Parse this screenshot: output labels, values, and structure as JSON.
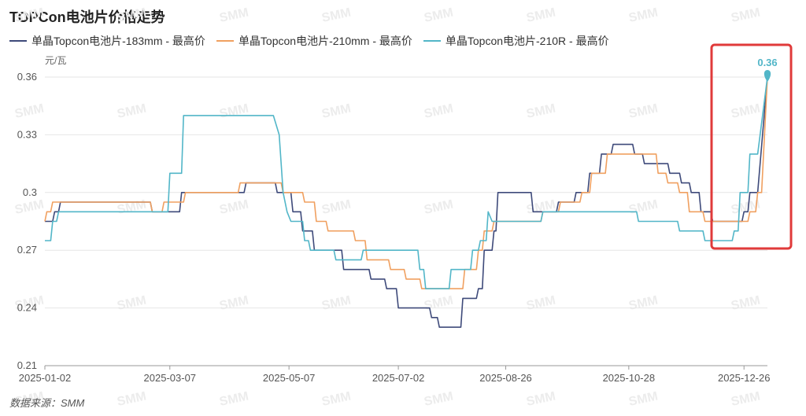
{
  "title": "TOPCon电池片价格走势",
  "unit_label": "元/瓦",
  "source": "数据来源：SMM",
  "watermark": "SMM",
  "colors": {
    "s183": "#3e4a7a",
    "s210": "#f0a060",
    "s210r": "#52b6c8",
    "highlight": "#e03a3a"
  },
  "chart_data": {
    "type": "line",
    "ylim": [
      0.21,
      0.36
    ],
    "yticks": [
      0.21,
      0.24,
      0.27,
      0.3,
      0.33,
      0.36
    ],
    "ytick_labels": [
      "0.21",
      "0.24",
      "0.27",
      "0.3",
      "0.33",
      "0.36"
    ],
    "xtick_labels": [
      "2025-01-02",
      "2025-03-07",
      "2025-05-07",
      "2025-07-02",
      "2025-08-26",
      "2025-10-28",
      "2025-12-26"
    ],
    "x_range": [
      "2025-01-02",
      "2026-01-07"
    ],
    "annotation": {
      "date": "2026-01-07",
      "value": 0.36,
      "label": "0.36"
    },
    "series": [
      {
        "name": "单晶Topcon电池片-183mm - 最高价",
        "color": "#3e4a7a",
        "points": [
          [
            "2025-01-02",
            0.285
          ],
          [
            "2025-01-06",
            0.285
          ],
          [
            "2025-01-07",
            0.29
          ],
          [
            "2025-01-09",
            0.29
          ],
          [
            "2025-01-10",
            0.295
          ],
          [
            "2025-02-25",
            0.295
          ],
          [
            "2025-02-26",
            0.29
          ],
          [
            "2025-03-12",
            0.29
          ],
          [
            "2025-03-13",
            0.3
          ],
          [
            "2025-04-14",
            0.3
          ],
          [
            "2025-04-15",
            0.305
          ],
          [
            "2025-04-30",
            0.305
          ],
          [
            "2025-05-01",
            0.3
          ],
          [
            "2025-05-08",
            0.3
          ],
          [
            "2025-05-09",
            0.29
          ],
          [
            "2025-05-13",
            0.29
          ],
          [
            "2025-05-14",
            0.28
          ],
          [
            "2025-05-19",
            0.28
          ],
          [
            "2025-05-20",
            0.27
          ],
          [
            "2025-05-26",
            0.27
          ],
          [
            "2025-05-27",
            0.27
          ],
          [
            "2025-06-03",
            0.27
          ],
          [
            "2025-06-04",
            0.26
          ],
          [
            "2025-06-17",
            0.26
          ],
          [
            "2025-06-18",
            0.255
          ],
          [
            "2025-06-25",
            0.255
          ],
          [
            "2025-06-26",
            0.25
          ],
          [
            "2025-07-01",
            0.25
          ],
          [
            "2025-07-02",
            0.24
          ],
          [
            "2025-07-18",
            0.24
          ],
          [
            "2025-07-19",
            0.235
          ],
          [
            "2025-07-22",
            0.235
          ],
          [
            "2025-07-23",
            0.23
          ],
          [
            "2025-08-03",
            0.23
          ],
          [
            "2025-08-04",
            0.245
          ],
          [
            "2025-08-11",
            0.245
          ],
          [
            "2025-08-12",
            0.25
          ],
          [
            "2025-08-14",
            0.25
          ],
          [
            "2025-08-15",
            0.27
          ],
          [
            "2025-08-19",
            0.27
          ],
          [
            "2025-08-20",
            0.28
          ],
          [
            "2025-08-21",
            0.28
          ],
          [
            "2025-08-22",
            0.3
          ],
          [
            "2025-09-08",
            0.3
          ],
          [
            "2025-09-09",
            0.29
          ],
          [
            "2025-09-21",
            0.29
          ],
          [
            "2025-09-22",
            0.295
          ],
          [
            "2025-09-30",
            0.295
          ],
          [
            "2025-10-01",
            0.3
          ],
          [
            "2025-10-07",
            0.3
          ],
          [
            "2025-10-08",
            0.31
          ],
          [
            "2025-10-13",
            0.31
          ],
          [
            "2025-10-14",
            0.32
          ],
          [
            "2025-10-19",
            0.32
          ],
          [
            "2025-10-20",
            0.325
          ],
          [
            "2025-10-30",
            0.325
          ],
          [
            "2025-10-31",
            0.32
          ],
          [
            "2025-11-04",
            0.32
          ],
          [
            "2025-11-05",
            0.315
          ],
          [
            "2025-11-17",
            0.315
          ],
          [
            "2025-11-18",
            0.31
          ],
          [
            "2025-11-23",
            0.31
          ],
          [
            "2025-11-24",
            0.305
          ],
          [
            "2025-11-28",
            0.305
          ],
          [
            "2025-11-29",
            0.3
          ],
          [
            "2025-12-03",
            0.3
          ],
          [
            "2025-12-04",
            0.29
          ],
          [
            "2025-12-09",
            0.29
          ],
          [
            "2025-12-10",
            0.285
          ],
          [
            "2025-12-25",
            0.285
          ],
          [
            "2025-12-26",
            0.29
          ],
          [
            "2025-12-28",
            0.29
          ],
          [
            "2025-12-29",
            0.3
          ],
          [
            "2026-01-02",
            0.3
          ],
          [
            "2026-01-07",
            0.36
          ]
        ]
      },
      {
        "name": "单晶Topcon电池片-210mm - 最高价",
        "color": "#f0a060",
        "points": [
          [
            "2025-01-02",
            0.285
          ],
          [
            "2025-01-03",
            0.29
          ],
          [
            "2025-01-05",
            0.29
          ],
          [
            "2025-01-06",
            0.295
          ],
          [
            "2025-02-25",
            0.295
          ],
          [
            "2025-02-26",
            0.29
          ],
          [
            "2025-03-03",
            0.29
          ],
          [
            "2025-03-04",
            0.295
          ],
          [
            "2025-03-14",
            0.295
          ],
          [
            "2025-03-15",
            0.3
          ],
          [
            "2025-04-11",
            0.3
          ],
          [
            "2025-04-12",
            0.305
          ],
          [
            "2025-05-03",
            0.305
          ],
          [
            "2025-05-04",
            0.3
          ],
          [
            "2025-05-14",
            0.3
          ],
          [
            "2025-05-15",
            0.295
          ],
          [
            "2025-05-20",
            0.295
          ],
          [
            "2025-05-21",
            0.285
          ],
          [
            "2025-05-26",
            0.285
          ],
          [
            "2025-05-27",
            0.28
          ],
          [
            "2025-06-09",
            0.28
          ],
          [
            "2025-06-10",
            0.275
          ],
          [
            "2025-06-15",
            0.275
          ],
          [
            "2025-06-16",
            0.265
          ],
          [
            "2025-06-27",
            0.265
          ],
          [
            "2025-06-28",
            0.26
          ],
          [
            "2025-07-05",
            0.26
          ],
          [
            "2025-07-06",
            0.255
          ],
          [
            "2025-07-13",
            0.255
          ],
          [
            "2025-07-14",
            0.25
          ],
          [
            "2025-08-04",
            0.25
          ],
          [
            "2025-08-05",
            0.26
          ],
          [
            "2025-08-11",
            0.26
          ],
          [
            "2025-08-12",
            0.27
          ],
          [
            "2025-08-14",
            0.27
          ],
          [
            "2025-08-15",
            0.28
          ],
          [
            "2025-08-19",
            0.28
          ],
          [
            "2025-08-20",
            0.285
          ],
          [
            "2025-09-13",
            0.285
          ],
          [
            "2025-09-14",
            0.29
          ],
          [
            "2025-09-22",
            0.29
          ],
          [
            "2025-09-23",
            0.295
          ],
          [
            "2025-10-03",
            0.295
          ],
          [
            "2025-10-04",
            0.3
          ],
          [
            "2025-10-08",
            0.3
          ],
          [
            "2025-10-09",
            0.31
          ],
          [
            "2025-10-16",
            0.31
          ],
          [
            "2025-10-17",
            0.32
          ],
          [
            "2025-11-11",
            0.32
          ],
          [
            "2025-11-12",
            0.31
          ],
          [
            "2025-11-16",
            0.31
          ],
          [
            "2025-11-17",
            0.305
          ],
          [
            "2025-11-22",
            0.305
          ],
          [
            "2025-11-23",
            0.3
          ],
          [
            "2025-11-27",
            0.3
          ],
          [
            "2025-11-28",
            0.29
          ],
          [
            "2025-12-05",
            0.29
          ],
          [
            "2025-12-06",
            0.285
          ],
          [
            "2025-12-28",
            0.285
          ],
          [
            "2025-12-29",
            0.29
          ],
          [
            "2026-01-01",
            0.29
          ],
          [
            "2026-01-02",
            0.3
          ],
          [
            "2026-01-04",
            0.3
          ],
          [
            "2026-01-07",
            0.36
          ]
        ]
      },
      {
        "name": "单晶Topcon电池片-210R - 最高价",
        "color": "#52b6c8",
        "points": [
          [
            "2025-01-02",
            0.275
          ],
          [
            "2025-01-05",
            0.275
          ],
          [
            "2025-01-06",
            0.285
          ],
          [
            "2025-01-08",
            0.285
          ],
          [
            "2025-01-09",
            0.29
          ],
          [
            "2025-03-06",
            0.29
          ],
          [
            "2025-03-07",
            0.31
          ],
          [
            "2025-03-13",
            0.31
          ],
          [
            "2025-03-14",
            0.34
          ],
          [
            "2025-04-29",
            0.34
          ],
          [
            "2025-05-02",
            0.33
          ],
          [
            "2025-05-04",
            0.3
          ],
          [
            "2025-05-06",
            0.29
          ],
          [
            "2025-05-08",
            0.285
          ],
          [
            "2025-05-14",
            0.285
          ],
          [
            "2025-05-15",
            0.275
          ],
          [
            "2025-05-17",
            0.275
          ],
          [
            "2025-05-18",
            0.27
          ],
          [
            "2025-05-30",
            0.27
          ],
          [
            "2025-05-31",
            0.265
          ],
          [
            "2025-06-13",
            0.265
          ],
          [
            "2025-06-14",
            0.27
          ],
          [
            "2025-07-12",
            0.27
          ],
          [
            "2025-07-13",
            0.26
          ],
          [
            "2025-07-15",
            0.26
          ],
          [
            "2025-07-16",
            0.25
          ],
          [
            "2025-07-28",
            0.25
          ],
          [
            "2025-07-29",
            0.26
          ],
          [
            "2025-08-08",
            0.26
          ],
          [
            "2025-08-09",
            0.27
          ],
          [
            "2025-08-12",
            0.27
          ],
          [
            "2025-08-13",
            0.275
          ],
          [
            "2025-08-16",
            0.275
          ],
          [
            "2025-08-17",
            0.29
          ],
          [
            "2025-08-19",
            0.285
          ],
          [
            "2025-09-13",
            0.285
          ],
          [
            "2025-09-14",
            0.29
          ],
          [
            "2025-11-01",
            0.29
          ],
          [
            "2025-11-02",
            0.285
          ],
          [
            "2025-11-22",
            0.285
          ],
          [
            "2025-11-23",
            0.28
          ],
          [
            "2025-12-05",
            0.28
          ],
          [
            "2025-12-06",
            0.275
          ],
          [
            "2025-12-20",
            0.275
          ],
          [
            "2025-12-21",
            0.28
          ],
          [
            "2025-12-23",
            0.28
          ],
          [
            "2025-12-24",
            0.3
          ],
          [
            "2025-12-28",
            0.3
          ],
          [
            "2025-12-29",
            0.32
          ],
          [
            "2026-01-02",
            0.32
          ],
          [
            "2026-01-07",
            0.36
          ]
        ]
      }
    ]
  }
}
